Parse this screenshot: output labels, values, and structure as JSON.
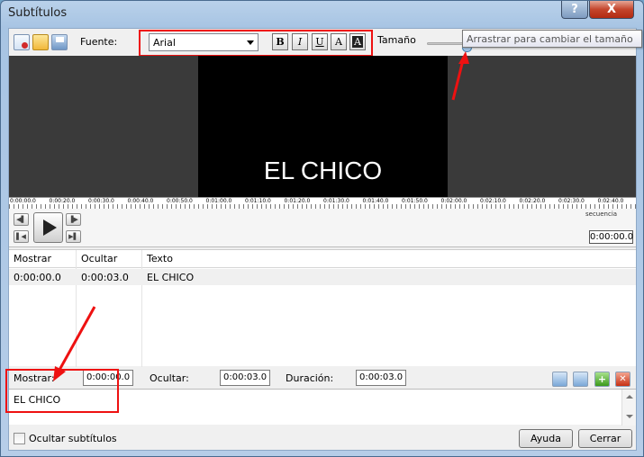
{
  "window": {
    "title": "Subtítulos",
    "help_glyph": "?",
    "close_glyph": "X"
  },
  "toolbar": {
    "font_label": "Fuente:",
    "font_value": "Arial",
    "bold": "B",
    "italic": "I",
    "underline": "U",
    "color_a": "A",
    "bg_a": "A",
    "size_label": "Tamaño",
    "tooltip": "Arrastrar para cambiar el tamaño",
    "size_slider_fraction": 0.2
  },
  "preview": {
    "subtitle_text": "EL CHICO"
  },
  "timeline": {
    "ticks": [
      "0:00:00.0",
      "0:00:20.0",
      "0:00:30.0",
      "0:00:40.0",
      "0:00:50.0",
      "0:01:00.0",
      "0:01:10.0",
      "0:01:20.0",
      "0:01:30.0",
      "0:01:40.0",
      "0:01:50.0",
      "0:02:00.0",
      "0:02:10.0",
      "0:02:20.0",
      "0:02:30.0",
      "0:02:40.0"
    ],
    "sequence_label": "secuencia",
    "current_time": "0:00:00.0"
  },
  "table": {
    "headers": [
      "Mostrar",
      "Ocultar",
      "Texto"
    ],
    "rows": [
      {
        "show": "0:00:00.0",
        "hide": "0:00:03.0",
        "text": "EL CHICO"
      }
    ]
  },
  "editor": {
    "show_label": "Mostrar:",
    "show_value": "0:00:00.0",
    "hide_label": "Ocultar:",
    "hide_value": "0:00:03.0",
    "duration_label": "Duración:",
    "duration_value": "0:00:03.0",
    "add_glyph": "+",
    "delete_glyph": "✕",
    "text": "EL CHICO"
  },
  "footer": {
    "hide_subtitles_label": "Ocultar subtítulos",
    "help_button": "Ayuda",
    "close_button": "Cerrar"
  },
  "colors": {
    "annotation": "#ee1111",
    "title_bar": "#b9d1ea"
  }
}
